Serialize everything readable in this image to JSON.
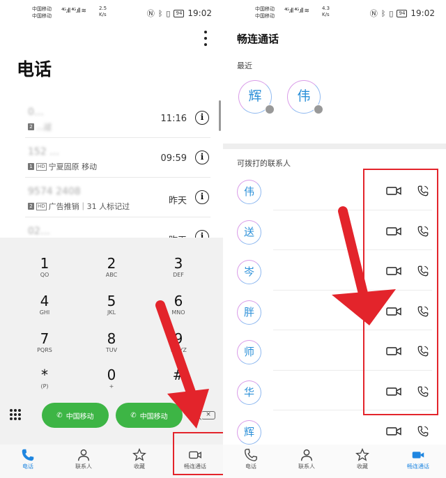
{
  "left": {
    "status": {
      "carrier1": "中国移动",
      "carrier2": "中国移动",
      "rate": "2.5",
      "rate_unit": "K/s",
      "battery": "94",
      "time": "19:02"
    },
    "title": "电话",
    "calls": [
      {
        "number": "0…",
        "sim": "2",
        "desc": "…过",
        "time": "11:16",
        "info": "i"
      },
      {
        "number": "152 …",
        "sim": "1",
        "desc": "宁夏固原 移动",
        "time": "09:59",
        "info": "i"
      },
      {
        "number": "9574 2408",
        "sim": "2",
        "desc": "广告推销｜31 人标记过",
        "time": "昨天",
        "info": "i"
      },
      {
        "number": "02…",
        "sim": "",
        "desc": "",
        "time": "昨天",
        "info": "i"
      }
    ],
    "keys": [
      {
        "d": "1",
        "l": "QO"
      },
      {
        "d": "2",
        "l": "ABC"
      },
      {
        "d": "3",
        "l": "DEF"
      },
      {
        "d": "4",
        "l": "GHI"
      },
      {
        "d": "5",
        "l": "JKL"
      },
      {
        "d": "6",
        "l": "MNO"
      },
      {
        "d": "7",
        "l": "PQRS"
      },
      {
        "d": "8",
        "l": "TUV"
      },
      {
        "d": "9",
        "l": "WXYZ"
      },
      {
        "d": "*",
        "l": "(P)"
      },
      {
        "d": "0",
        "l": "+"
      },
      {
        "d": "#",
        "l": ""
      }
    ],
    "call_buttons": [
      {
        "label": "中国移动",
        "sim": "1"
      },
      {
        "label": "中国移动",
        "sim": "2"
      }
    ],
    "tabs": [
      {
        "label": "电话"
      },
      {
        "label": "联系人"
      },
      {
        "label": "收藏"
      },
      {
        "label": "畅连通话"
      }
    ]
  },
  "right": {
    "status": {
      "carrier1": "中国移动",
      "carrier2": "中国移动",
      "rate": "4.3",
      "rate_unit": "K/s",
      "battery": "94",
      "time": "19:02"
    },
    "title": "畅连通话",
    "recent_label": "最近",
    "recent": [
      {
        "char": "辉"
      },
      {
        "char": "伟"
      }
    ],
    "contacts_label": "可拨打的联系人",
    "contacts": [
      {
        "char": "伟"
      },
      {
        "char": "送"
      },
      {
        "char": "岑"
      },
      {
        "char": "胖"
      },
      {
        "char": "师"
      },
      {
        "char": "华"
      },
      {
        "char": "辉"
      }
    ],
    "tabs": [
      {
        "label": "电话"
      },
      {
        "label": "联系人"
      },
      {
        "label": "收藏"
      },
      {
        "label": "畅连通话"
      }
    ]
  },
  "colors": {
    "accent": "#1f86e0",
    "call_green": "#3db545",
    "annotation_red": "#e3242b",
    "avatar_text": "#2a8fd8"
  }
}
